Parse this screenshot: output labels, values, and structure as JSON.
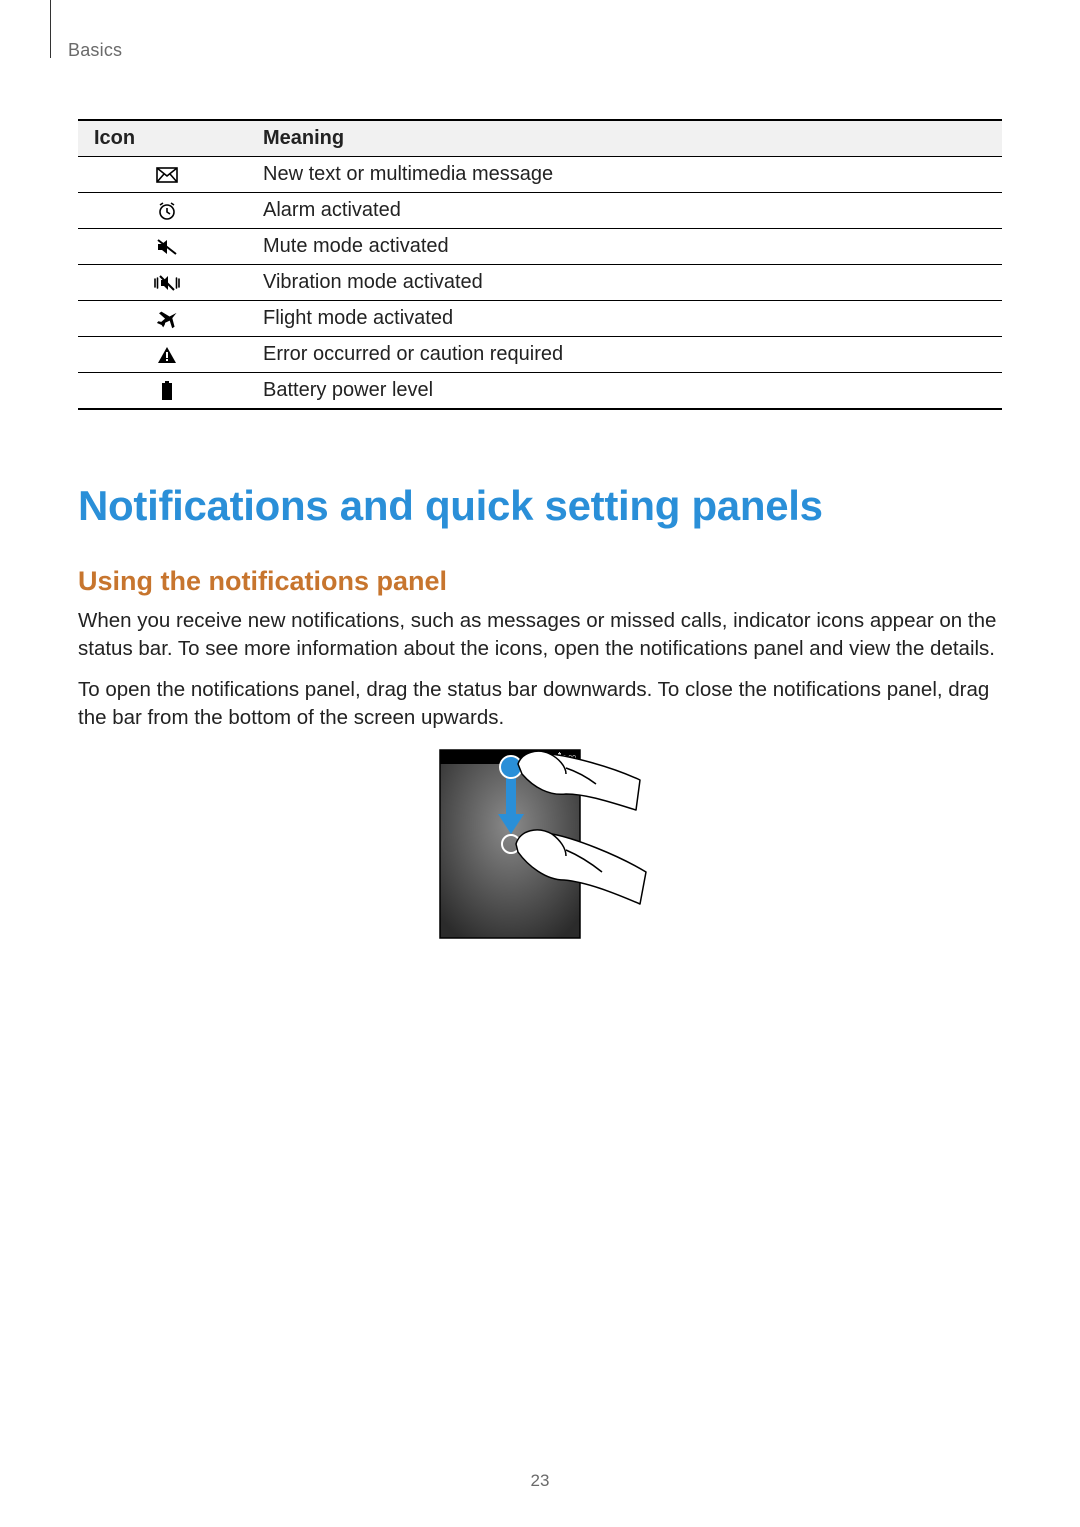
{
  "breadcrumb": "Basics",
  "table": {
    "headers": {
      "icon": "Icon",
      "meaning": "Meaning"
    },
    "rows": [
      {
        "icon": "message-icon",
        "meaning": "New text or multimedia message"
      },
      {
        "icon": "alarm-icon",
        "meaning": "Alarm activated"
      },
      {
        "icon": "mute-icon",
        "meaning": "Mute mode activated"
      },
      {
        "icon": "vibration-icon",
        "meaning": "Vibration mode activated"
      },
      {
        "icon": "flight-icon",
        "meaning": "Flight mode activated"
      },
      {
        "icon": "warning-icon",
        "meaning": "Error occurred or caution required"
      },
      {
        "icon": "battery-icon",
        "meaning": "Battery power level"
      }
    ]
  },
  "section_title": "Notifications and quick setting panels",
  "sub_title": "Using the notifications panel",
  "paragraphs": {
    "p1": "When you receive new notifications, such as messages or missed calls, indicator icons appear on the status bar. To see more information about the icons, open the notifications panel and view the details.",
    "p2": "To open the notifications panel, drag the status bar downwards. To close the notifications panel, drag the bar from the bottom of the screen upwards."
  },
  "illustration": {
    "status_time": "10:00"
  },
  "page_number": "23"
}
